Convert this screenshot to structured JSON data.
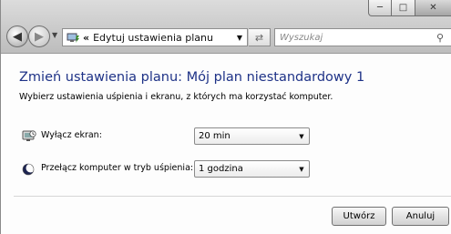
{
  "window": {
    "caption_buttons": {
      "minimize_icon": "minimize-icon",
      "maximize_icon": "maximize-icon",
      "close_icon": "close-icon"
    }
  },
  "toolbar": {
    "breadcrumb_chevron": "«",
    "address_text": "Edytuj ustawienia planu",
    "search_placeholder": "Wyszukaj"
  },
  "main": {
    "title": "Zmień ustawienia planu: Mój plan niestandardowy 1",
    "subtitle": "Wybierz ustawienia uśpienia i ekranu, z których ma korzystać komputer.",
    "settings": [
      {
        "label": "Wyłącz ekran:",
        "value": "20 min",
        "icon": "display-icon"
      },
      {
        "label": "Przełącz komputer w tryb uśpienia:",
        "value": "1 godzina",
        "icon": "sleep-moon-icon"
      }
    ]
  },
  "buttons": {
    "create": "Utwórz",
    "cancel": "Anuluj"
  },
  "colors": {
    "heading": "#1e3287",
    "chrome": "#c9c9c9"
  }
}
